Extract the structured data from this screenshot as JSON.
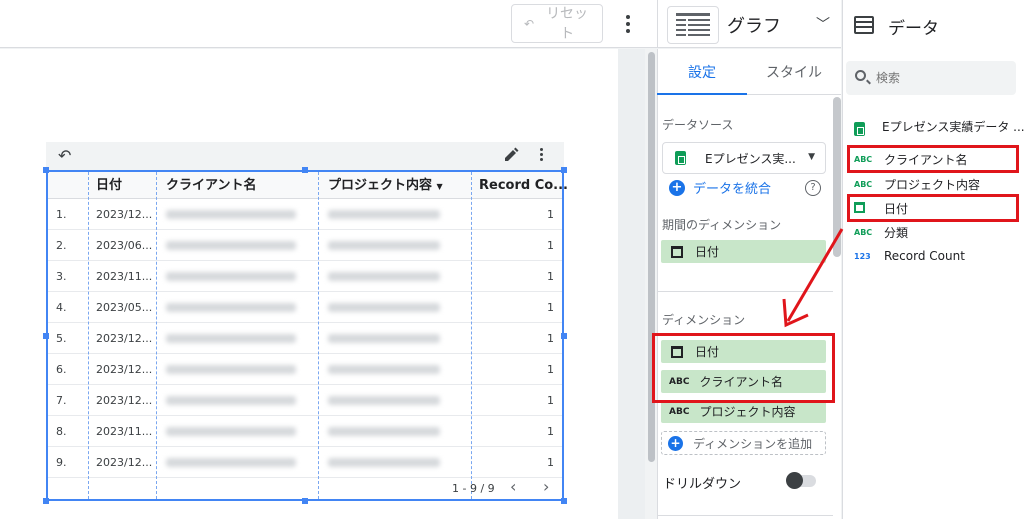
{
  "toolbar": {
    "reset_label": "リセット",
    "undo_icon": "undo-icon"
  },
  "table": {
    "columns": [
      "日付",
      "クライアント名",
      "プロジェクト内容",
      "Record Co..."
    ],
    "sort_column": "プロジェクト内容",
    "rows": [
      {
        "n": "1.",
        "date": "2023/12...",
        "count": "1"
      },
      {
        "n": "2.",
        "date": "2023/06...",
        "count": "1"
      },
      {
        "n": "3.",
        "date": "2023/11...",
        "count": "1"
      },
      {
        "n": "4.",
        "date": "2023/05...",
        "count": "1"
      },
      {
        "n": "5.",
        "date": "2023/12...",
        "count": "1"
      },
      {
        "n": "6.",
        "date": "2023/12...",
        "count": "1"
      },
      {
        "n": "7.",
        "date": "2023/12...",
        "count": "1"
      },
      {
        "n": "8.",
        "date": "2023/11...",
        "count": "1"
      },
      {
        "n": "9.",
        "date": "2023/12...",
        "count": "1"
      }
    ],
    "pagination": "1 - 9 / 9"
  },
  "props": {
    "chart_type": "グラフ",
    "tabs": [
      "設定",
      "スタイル"
    ],
    "datasource_label": "データソース",
    "datasource_value": "Eプレゼンス実...",
    "blend_label": "データを統合",
    "period_dimension_label": "期間のディメンション",
    "period_dimension": "日付",
    "dimension_label": "ディメンション",
    "dimensions": [
      "日付",
      "クライアント名",
      "プロジェクト内容"
    ],
    "add_dimension": "ディメンションを追加",
    "drilldown_label": "ドリルダウン"
  },
  "data_panel": {
    "title": "データ",
    "search_placeholder": "検索",
    "source_name": "Eプレゼンス実績データ ...",
    "fields": [
      {
        "type": "ABC",
        "name": "クライアント名"
      },
      {
        "type": "ABC",
        "name": "プロジェクト内容"
      },
      {
        "type": "date",
        "name": "日付"
      },
      {
        "type": "ABC",
        "name": "分類"
      },
      {
        "type": "123",
        "name": "Record Count"
      }
    ]
  },
  "colors": {
    "accent": "#1a73e8",
    "selection": "#4285f4",
    "chip": "#c8e6c9",
    "highlight": "#e0151b"
  }
}
